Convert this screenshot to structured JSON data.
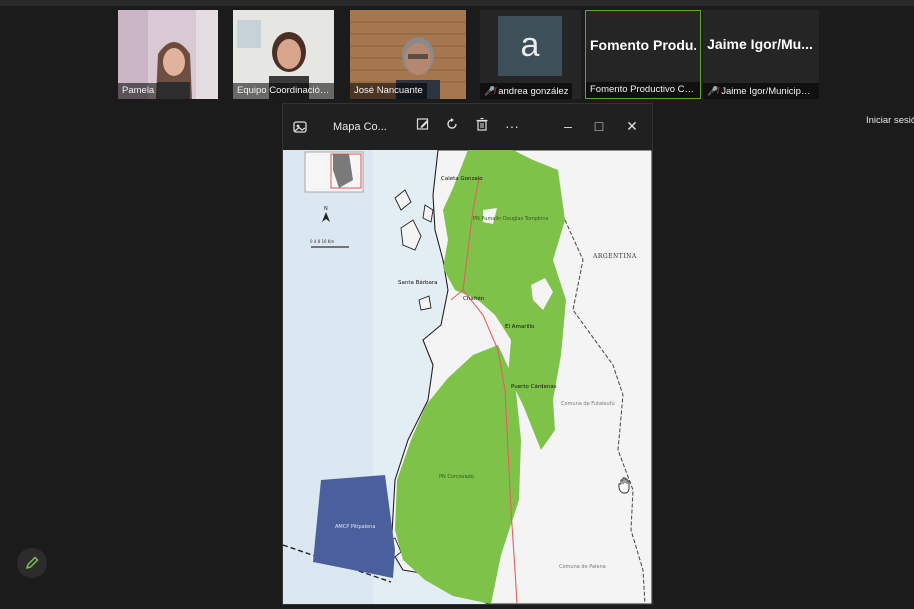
{
  "participants": [
    {
      "name": "Pamela",
      "muted": false
    },
    {
      "name": "Equipo Coordinación Estr...",
      "muted": false
    },
    {
      "name": "José Nancuante",
      "muted": false
    },
    {
      "name": "andrea gonzález",
      "muted": true,
      "avatar_letter": "a"
    },
    {
      "name": "Fomento Productivo Chai...",
      "muted": false,
      "display_label": "Fomento Produ..."
    },
    {
      "name": "Jaime Igor/Municipali...",
      "muted": true,
      "display_label": "Jaime Igor/Mu..."
    }
  ],
  "meeting": {
    "signin_label": "Iniciar sesión"
  },
  "viewer": {
    "title": "Mapa Co...",
    "icons": [
      "photos-app-icon",
      "edit-icon",
      "rotate-icon",
      "delete-icon",
      "more-icon",
      "minimize-icon",
      "maximize-icon",
      "close-icon"
    ],
    "more_label": "···",
    "minimize_label": "–",
    "maximize_label": "□",
    "close_label": "✕"
  },
  "map": {
    "labels": {
      "caleta_gonzalo": "Caleta Gonzalo",
      "pumalin": "PN Pumalín Douglas Tompkins",
      "argentina": "ARGENTINA",
      "santa_barbara": "Santa Bárbara",
      "chaiten": "Chaitén",
      "el_amarillo": "El Amarillo",
      "puerto_cardenas": "Puerto Cárdenas",
      "comuna_futaleufu": "Comuna de Futaleufú",
      "corcovado": "PN Corcovado",
      "comuna_palena": "Comuna de Palena",
      "amp": "AMCP Pitipalena",
      "scale": "0  4  8       16 Km",
      "north": "N"
    },
    "colors": {
      "sea": "#e3edf4",
      "land": "#f4f4f4",
      "park": "#7fc24a",
      "marine": "#4b5f9c",
      "road": "#e06060"
    }
  },
  "fab": {
    "icon": "pencil-icon"
  }
}
